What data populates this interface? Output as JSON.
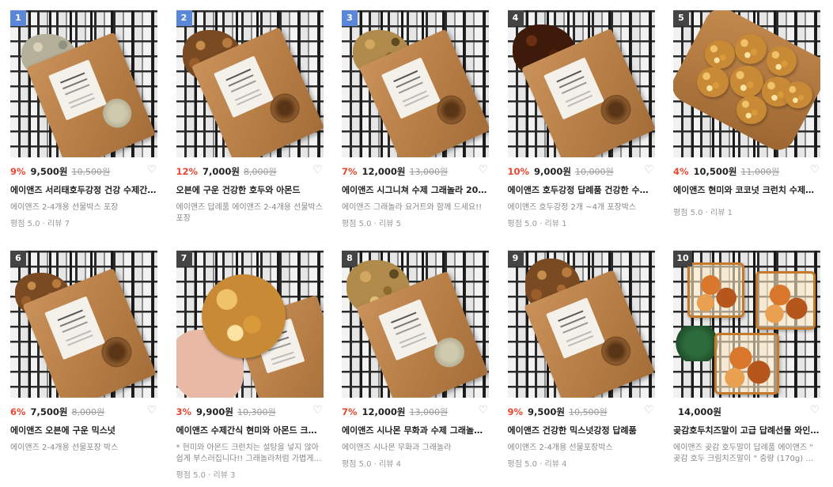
{
  "products": [
    {
      "rank": "1",
      "discount": "9%",
      "price": "9,500원",
      "original": "10,500원",
      "title": "에이앤즈 서리태호두강정 건강 수제간식...",
      "desc": "에이앤즈 2-4개용 선물박스 포장",
      "meta": "평점 5.0 · 리뷰 7",
      "badge_color": "#5b87d8"
    },
    {
      "rank": "2",
      "discount": "12%",
      "price": "7,000원",
      "original": "8,000원",
      "title": "오븐에 구운 건강한 호두와 아몬드",
      "desc": "에이앤즈 답례품 에이앤즈 2-4개용 선물박스 포장",
      "meta": "",
      "badge_color": "#5b87d8"
    },
    {
      "rank": "3",
      "discount": "7%",
      "price": "12,000원",
      "original": "13,000원",
      "title": "에이앤즈 시그니쳐 수제 그래놀라 200g",
      "desc": "에이앤즈 그래놀라 요거트와 함께 드세요!!",
      "meta": "평점 5.0 · 리뷰 5",
      "badge_color": "#5b87d8"
    },
    {
      "rank": "4",
      "discount": "10%",
      "price": "9,000원",
      "original": "10,000원",
      "title": "에이앤즈 호두강정 답례품 건강한 수제 ...",
      "desc": "에이앤즈 호두강정 2개 ~4개 포장박스",
      "meta": "평점 5.0 · 리뷰 1",
      "badge_color": "#444444"
    },
    {
      "rank": "5",
      "discount": "4%",
      "price": "10,500원",
      "original": "11,000원",
      "title": "에이앤즈 현미와 코코넛 크런치 수제간식",
      "desc": "",
      "meta": "평점 5.0 · 리뷰 1",
      "badge_color": "#444444"
    },
    {
      "rank": "6",
      "discount": "6%",
      "price": "7,500원",
      "original": "8,000원",
      "title": "에이앤즈 오븐에 구운 믹스넛",
      "desc": "에이앤즈 2-4개용 선물포장 박스",
      "meta": "",
      "badge_color": "#444444"
    },
    {
      "rank": "7",
      "discount": "3%",
      "price": "9,900원",
      "original": "10,300원",
      "title": "에이앤즈 수제간식 현미와 아몬드 크런치",
      "desc": "* 현미와 아몬드 크런치는 설탕을 넣지 않아 쉽게 부스러집니다!! 그래놀라처럼 가볍게 드...",
      "meta": "평점 5.0 · 리뷰 3",
      "badge_color": "#444444"
    },
    {
      "rank": "8",
      "discount": "7%",
      "price": "12,000원",
      "original": "13,000원",
      "title": "에이앤즈 시나몬 무화과 수제 그래놀라 ...",
      "desc": "에이앤즈 시나몬 무화과 그래놀라",
      "meta": "평점 5.0 · 리뷰 4",
      "badge_color": "#444444"
    },
    {
      "rank": "9",
      "discount": "9%",
      "price": "9,500원",
      "original": "10,500원",
      "title": "에이앤즈 건강한 믹스넛강정 답례품",
      "desc": "에이앤즈 2-4개용 선물포장박스",
      "meta": "평점 5.0 · 리뷰 4",
      "badge_color": "#444444"
    },
    {
      "rank": "10",
      "discount": "",
      "price": "14,000원",
      "original": "",
      "title": "곶감호두치즈말이 고급 답례선물 와인안...",
      "desc": "에이앤즈 곶감 호두말이 답례품 에이앤즈 \" 곶감 호두 크림치즈말이 \" 중량 (170g) 와인안...",
      "meta": "",
      "badge_color": "#444444"
    }
  ],
  "heart_icon": "♡",
  "colors": {
    "discount": "#e8462f",
    "badge_blue": "#5b87d8",
    "badge_gray": "#444444"
  }
}
